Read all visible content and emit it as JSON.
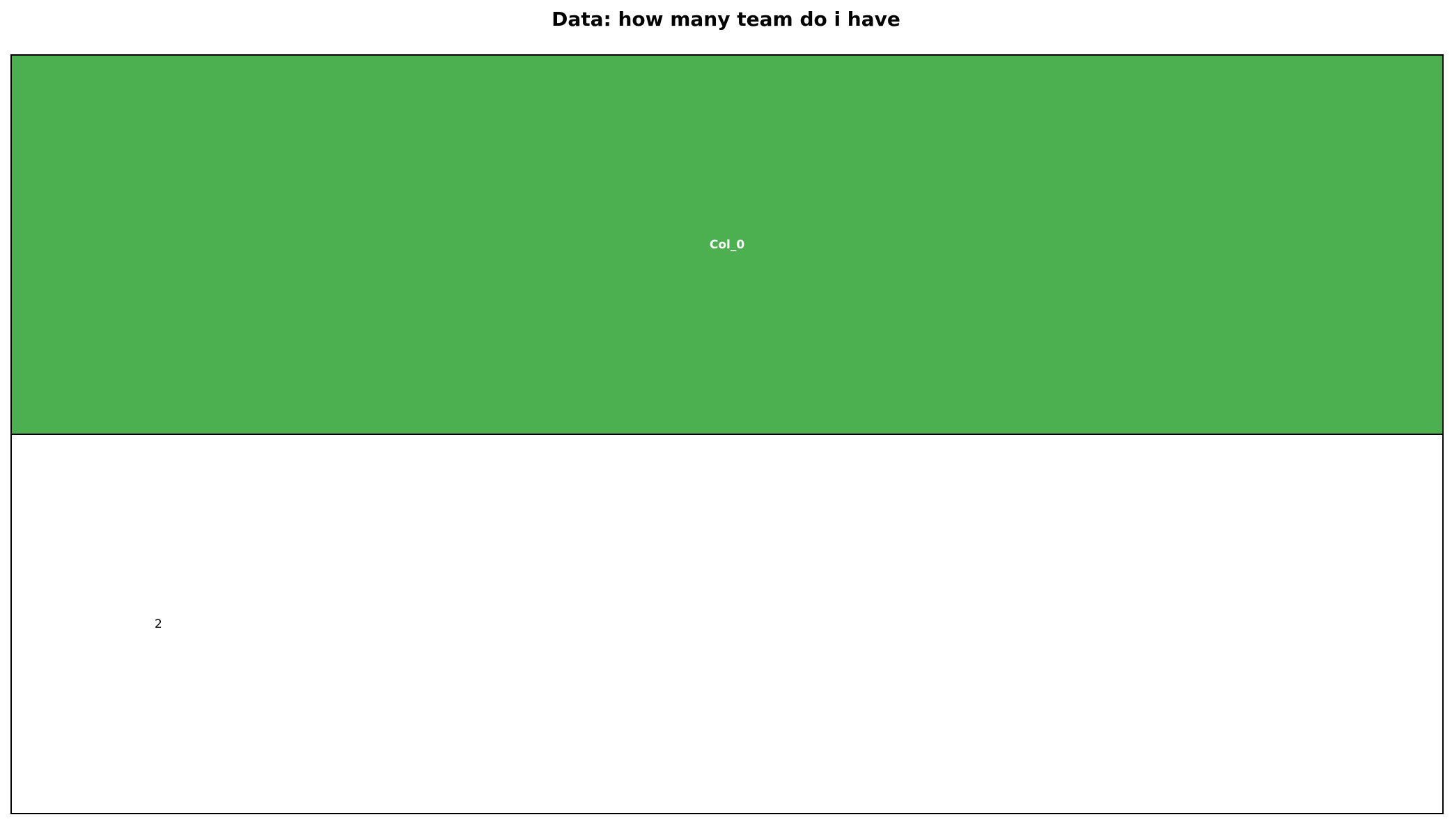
{
  "chart_data": {
    "type": "table",
    "title": "Data: how many team do i have",
    "columns": [
      "Col_0"
    ],
    "rows": [
      [
        "2"
      ]
    ],
    "header_color": "#4caf50",
    "header_text_color": "#ffffff",
    "cell_color": "#ffffff"
  }
}
